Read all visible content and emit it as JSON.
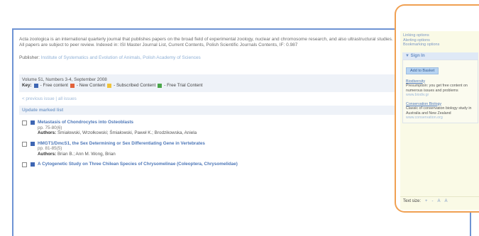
{
  "description": "Acta zoologica is an international quarterly journal that publishes papers on the broad field of experimental zoology, nuclear and chromosome research, and also ultrastructural studies. All papers are subject to peer review. Indexed in: ISI Master Journal List, Current Contents, Polish Scientific Journals Contents, IF: 0.987",
  "publisher": {
    "label": "Publisher:",
    "value": "Institute of Systematics and Evolution of Animals, Polish Academy of Sciences"
  },
  "issue": {
    "volume": "Volume 51, Numbers 3-4, September 2008",
    "key_label": "Key:",
    "legend": [
      {
        "label": "- Free content",
        "color": "#3e66b3"
      },
      {
        "label": "- New Content",
        "color": "#e2633b"
      },
      {
        "label": "- Subscribed Content",
        "color": "#f0c33a"
      },
      {
        "label": "- Free Trial Content",
        "color": "#4aa64a"
      }
    ]
  },
  "nav": {
    "previous": "< previous issue",
    "all_issues": "all issues"
  },
  "update_marked": "Update marked list",
  "articles": [
    {
      "title": "Metastasis of Chondrocytes into Osteoblasts",
      "pages": "pp. 75-80(6)",
      "authors_label": "Authors:",
      "authors": "Śmiałowski, Wrzołkowski; Śmiałowski, Paweł K.; Brodzikowska, Aniela"
    },
    {
      "title": "HMGT1/DmcS1, the Sex Determining or Sex Differentiating Gene in Vertebrates",
      "pages": "pp. 81-85(5)",
      "authors_label": "Authors:",
      "authors": "Brian B.; Ann M. Wong, Brian"
    },
    {
      "title": "A Cytogenetic Study on Three Chilean Species of Chrysomelinae (Coleoptera, Chrysomelidae)",
      "pages": "",
      "authors_label": "",
      "authors": ""
    }
  ],
  "sidebar": {
    "links": [
      "Linking options",
      "Alerting options",
      "Bookmarking options"
    ],
    "signin_label": "▼ Sign In",
    "add_button": "Add to Basket",
    "promos": [
      {
        "title": "Biodiversity",
        "text": "Presumption: you get free content on numerous issues and problems",
        "link": "www.biodiv.gr"
      },
      {
        "title": "Conservation Biology",
        "text": "Classic of conservation biology study in Australia and New Zealand",
        "link": "www.conservation.org"
      }
    ],
    "text_size_label": "Text size:",
    "text_size_options": [
      "+",
      "-",
      "A",
      "A"
    ]
  }
}
